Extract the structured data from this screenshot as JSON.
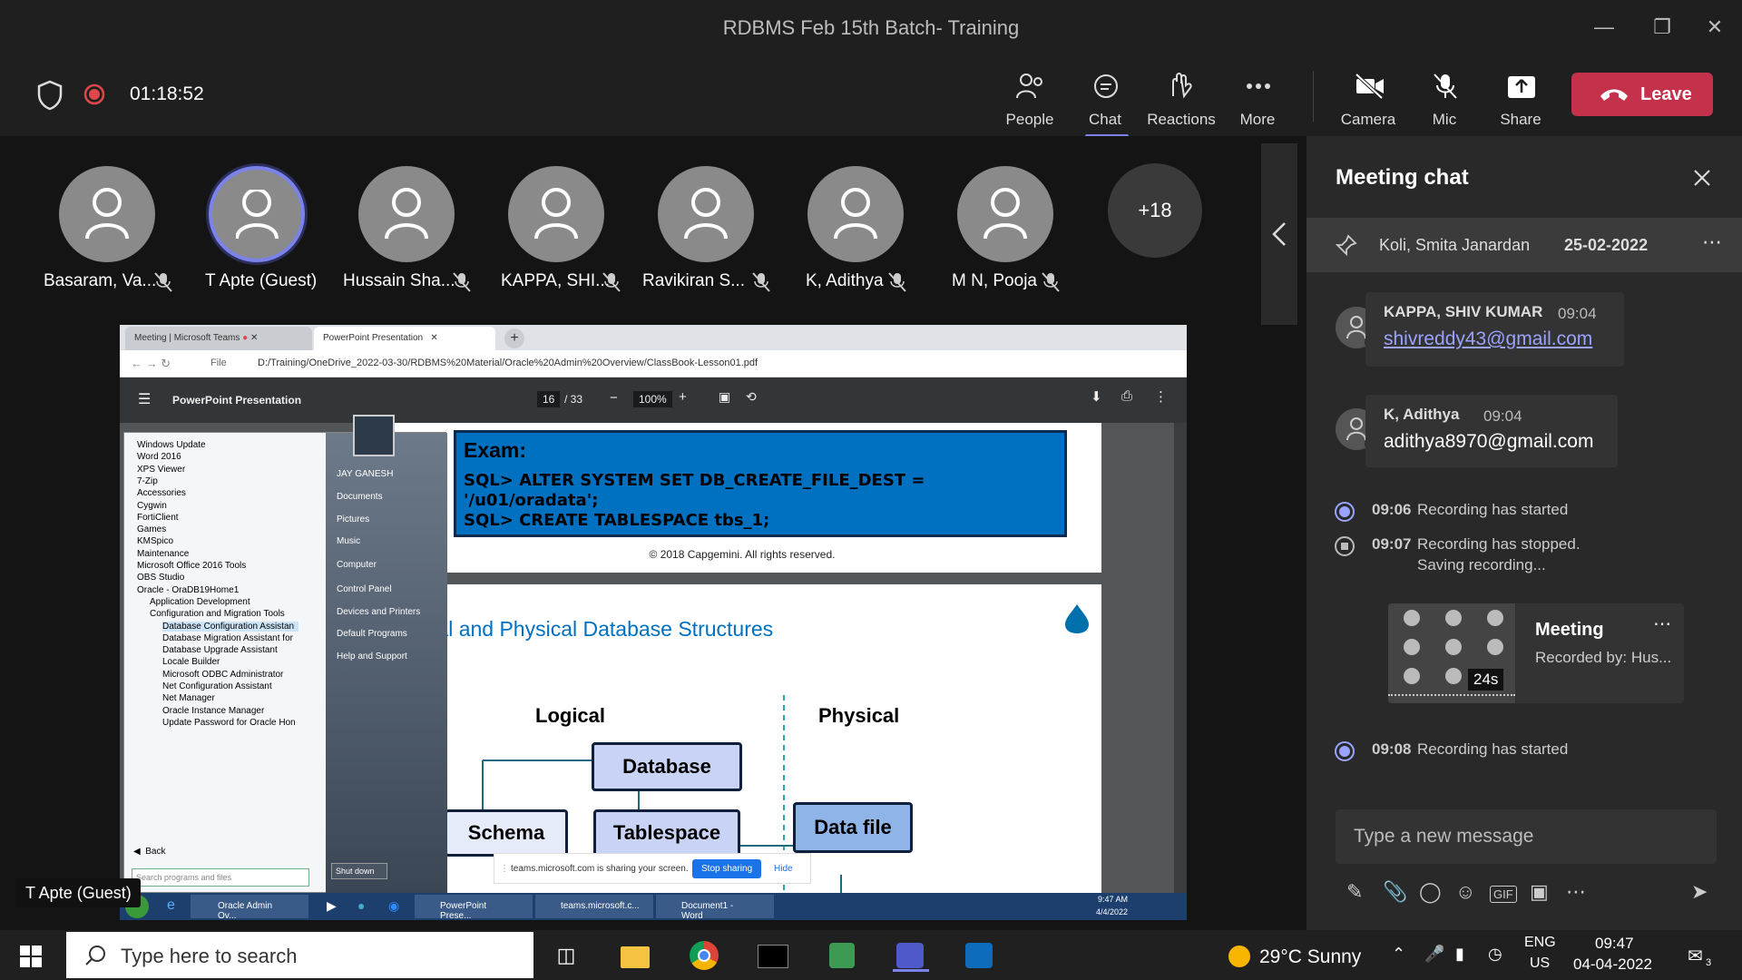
{
  "window": {
    "title": "RDBMS Feb 15th Batch- Training"
  },
  "meeting": {
    "timer": "01:18:52",
    "toolbar": [
      {
        "label": "People",
        "icon": "people-icon"
      },
      {
        "label": "Chat",
        "icon": "chat-icon"
      },
      {
        "label": "Reactions",
        "icon": "reactions-icon"
      },
      {
        "label": "More",
        "icon": "more-icon"
      }
    ],
    "controls": [
      {
        "label": "Camera",
        "icon": "camera-off-icon"
      },
      {
        "label": "Mic",
        "icon": "mic-off-icon"
      },
      {
        "label": "Share",
        "icon": "share-icon"
      }
    ],
    "leave_label": "Leave",
    "participants": [
      "Basaram, Va...",
      "T Apte (Guest)",
      "Hussain Sha...",
      "KAPPA, SHI...",
      "Ravikiran S...",
      "K, Adithya",
      "M N, Pooja"
    ],
    "overflow": "+18",
    "presenter_label": "T Apte (Guest)"
  },
  "shared": {
    "tab1": "Meeting | Microsoft Teams",
    "tab2": "PowerPoint Presentation",
    "url": "D:/Training/OneDrive_2022-03-30/RDBMS%20Material/Oracle%20Admin%20Overview/ClassBook-Lesson01.pdf",
    "file_label": "File",
    "pdf_title": "PowerPoint Presentation",
    "page": "16",
    "pages": "/ 33",
    "zoom": "100%",
    "exam_title": "Exam:",
    "exam_line1": "SQL> ALTER SYSTEM SET DB_CREATE_FILE_DEST =",
    "exam_line2": "'/u01/oradata';",
    "exam_line3": "SQL> CREATE TABLESPACE tbs_1;",
    "copyright": "© 2018 Capgemini. All rights reserved.",
    "slide_title": "gical and Physical Database Structures",
    "logical": "Logical",
    "physical": "Physical",
    "database": "Database",
    "schema": "Schema",
    "tablespace": "Tablespace",
    "datafile": "Data file",
    "start_items": [
      "Windows Update",
      "Word 2016",
      "XPS Viewer",
      "7-Zip",
      "Accessories",
      "Cygwin",
      "FortiClient",
      "Games",
      "KMSpico",
      "Maintenance",
      "Microsoft Office 2016 Tools",
      "OBS Studio",
      "Oracle - OraDB19Home1",
      "Application Development",
      "Configuration and Migration Tools",
      "Database Configuration Assistan",
      "Database Migration Assistant for",
      "Database Upgrade Assistant",
      "Locale Builder",
      "Microsoft ODBC Administrator",
      "Net Configuration Assistant",
      "Net Manager",
      "Oracle Instance Manager",
      "Update Password for Oracle Hon"
    ],
    "start_back": "Back",
    "start_search": "Search programs and files",
    "start_right": [
      "JAY GANESH",
      "Documents",
      "Pictures",
      "Music",
      "Computer",
      "Control Panel",
      "Devices and Printers",
      "Default Programs",
      "Help and Support"
    ],
    "shutdown": "Shut down",
    "sharing_msg": "teams.microsoft.com is sharing your screen.",
    "stop_sharing": "Stop sharing",
    "hide": "Hide",
    "task_items": [
      "Oracle Admin Ov...",
      "PowerPoint Prese...",
      "teams.microsoft.c...",
      "Document1 - Word"
    ],
    "task_time": "9:47 AM",
    "task_date": "4/4/2022"
  },
  "chat": {
    "header": "Meeting chat",
    "pinned_name": "Koli, Smita Janardan",
    "pinned_date": "25-02-2022",
    "messages": [
      {
        "name": "KAPPA, SHIV KUMAR",
        "time": "09:04",
        "text": "shivreddy43@gmail.com"
      },
      {
        "name": "K, Adithya",
        "time": "09:04",
        "text": "adithya8970@gmail.com"
      }
    ],
    "events": [
      {
        "time": "09:06",
        "text": "Recording has started"
      },
      {
        "time": "09:07",
        "text": "Recording has stopped.",
        "text2": "Saving recording..."
      },
      {
        "time": "09:08",
        "text": "Recording has started"
      }
    ],
    "recording": {
      "title": "Meeting",
      "by": "Recorded by: Hus...",
      "duration": "24s"
    },
    "input_placeholder": "Type a new message"
  },
  "taskbar": {
    "search_placeholder": "Type here to search",
    "weather": "29°C  Sunny",
    "lang1": "ENG",
    "lang2": "US",
    "time": "09:47",
    "date": "04-04-2022",
    "notif_count": "3"
  },
  "colors": {
    "leave": "#c4314b",
    "accent": "#7b83eb",
    "recording": "#e0474c"
  }
}
